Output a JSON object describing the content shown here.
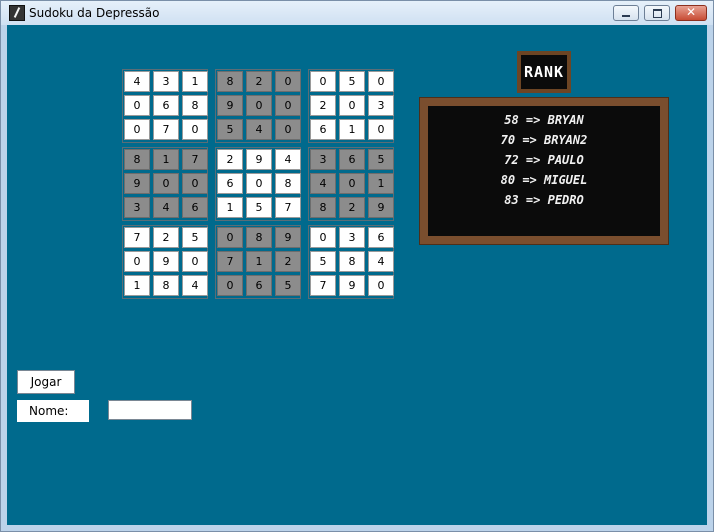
{
  "window": {
    "title": "Sudoku da Depressão"
  },
  "sudoku": {
    "rows": [
      [
        "4",
        "3",
        "1",
        "8",
        "2",
        "0",
        "0",
        "5",
        "0"
      ],
      [
        "0",
        "6",
        "8",
        "9",
        "0",
        "0",
        "2",
        "0",
        "3"
      ],
      [
        "0",
        "7",
        "0",
        "5",
        "4",
        "0",
        "6",
        "1",
        "0"
      ],
      [
        "8",
        "1",
        "7",
        "2",
        "9",
        "4",
        "3",
        "6",
        "5"
      ],
      [
        "9",
        "0",
        "0",
        "6",
        "0",
        "8",
        "4",
        "0",
        "1"
      ],
      [
        "3",
        "4",
        "6",
        "1",
        "5",
        "7",
        "8",
        "2",
        "9"
      ],
      [
        "7",
        "2",
        "5",
        "0",
        "8",
        "9",
        "0",
        "3",
        "6"
      ],
      [
        "0",
        "9",
        "0",
        "7",
        "1",
        "2",
        "5",
        "8",
        "4"
      ],
      [
        "1",
        "8",
        "4",
        "0",
        "6",
        "5",
        "7",
        "9",
        "0"
      ]
    ]
  },
  "rank": {
    "title": "RANK",
    "entries": [
      "58 => BRYAN",
      "70 => BRYAN2",
      "72 => PAULO",
      "80 => MIGUEL",
      "83 => PEDRO"
    ]
  },
  "controls": {
    "play_label": "Jogar",
    "name_label": "Nome:",
    "name_value": ""
  },
  "colors": {
    "background": "#006a8d",
    "gray_box": "#8c8c8c",
    "white_box": "#ffffff"
  }
}
